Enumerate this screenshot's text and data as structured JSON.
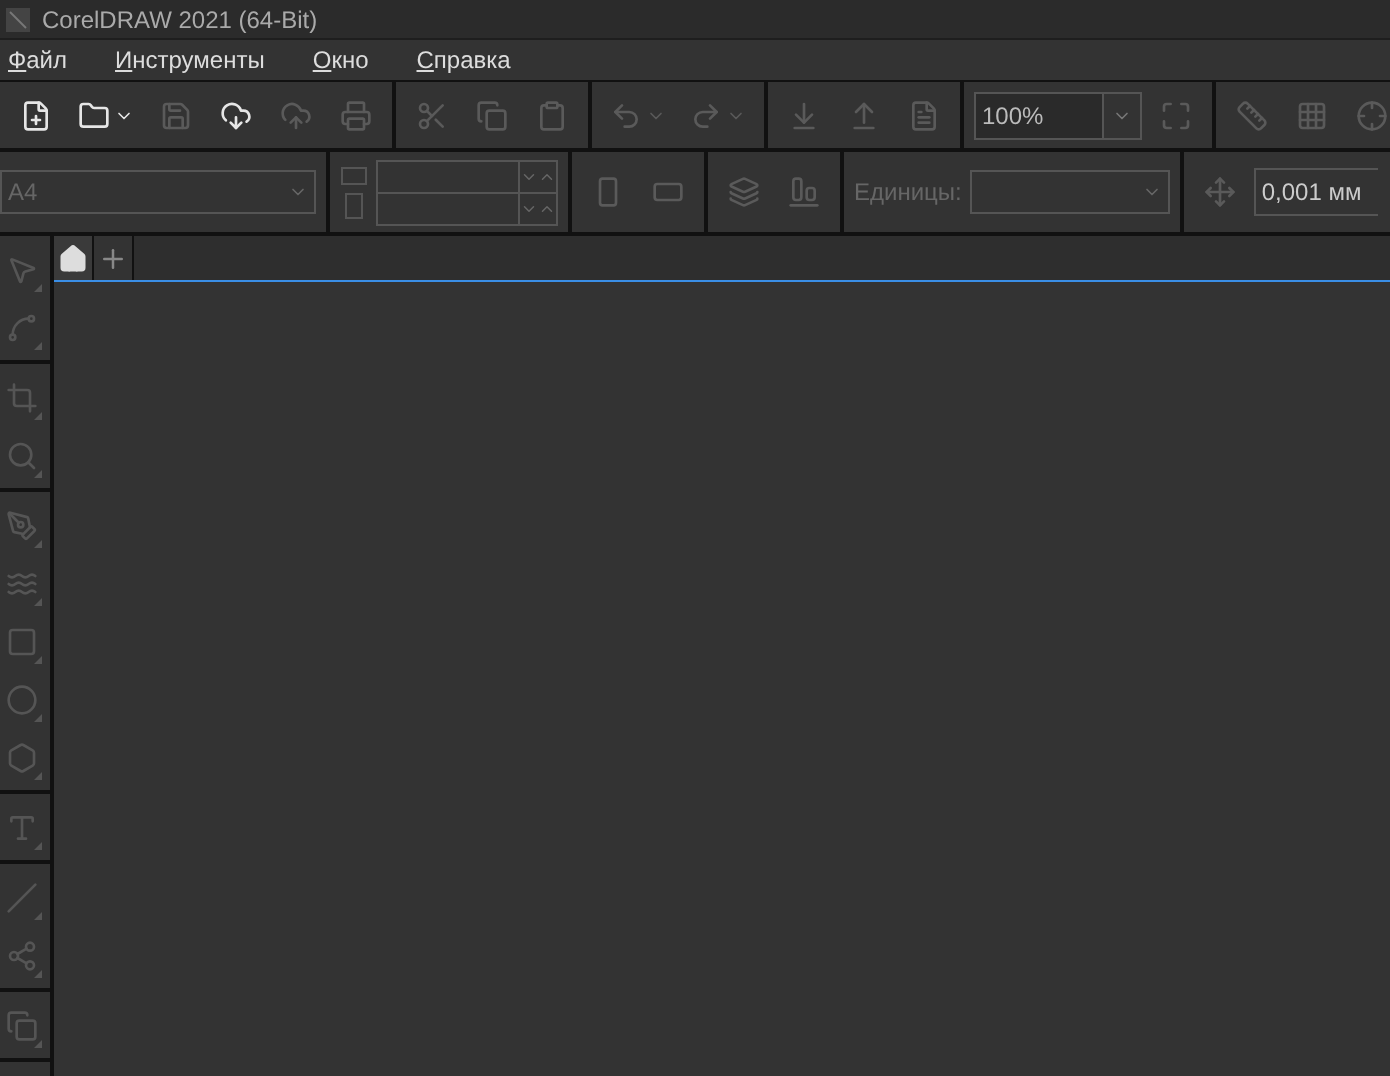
{
  "window": {
    "title": "CorelDRAW 2021 (64-Bit)"
  },
  "menu": [
    "Файл",
    "Инструменты",
    "Окно",
    "Справка"
  ],
  "toolbar": {
    "groups": [
      [
        {
          "disabled": false,
          "menu": false
        },
        {
          "disabled": false,
          "menu": true
        },
        {
          "disabled": true,
          "menu": false
        },
        {
          "disabled": false,
          "menu": false
        },
        {
          "disabled": true,
          "menu": false
        },
        {
          "disabled": true,
          "menu": false
        }
      ],
      [
        {
          "disabled": true,
          "menu": false
        },
        {
          "disabled": true,
          "menu": false
        },
        {
          "disabled": true,
          "menu": false
        }
      ],
      [
        {
          "disabled": true,
          "menu": true
        },
        {
          "disabled": true,
          "menu": true
        }
      ],
      [
        {
          "disabled": true,
          "menu": false
        },
        {
          "disabled": true,
          "menu": false
        },
        {
          "disabled": true,
          "menu": false
        }
      ]
    ],
    "zoom": "100%",
    "view_groups": [
      [
        {
          "disabled": true,
          "menu": false
        }
      ],
      [
        {
          "disabled": true,
          "menu": false
        },
        {
          "disabled": true,
          "menu": false
        },
        {
          "disabled": true,
          "menu": false
        }
      ]
    ]
  },
  "property_bar": {
    "page_size": "A4",
    "units_label": "Единицы:",
    "nudge": "0,001 мм"
  },
  "tabs": [
    {
      "kind": "home",
      "selected": true
    },
    {
      "kind": "add",
      "selected": false
    }
  ],
  "toolbox": [
    [
      {
        "flyout": true
      },
      {
        "flyout": true
      }
    ],
    [
      {
        "flyout": true
      },
      {
        "flyout": true
      }
    ],
    [
      {
        "flyout": true
      },
      {
        "flyout": true
      },
      {
        "flyout": true
      },
      {
        "flyout": true
      },
      {
        "flyout": true
      }
    ],
    [
      {
        "flyout": true
      }
    ],
    [
      {
        "flyout": true
      },
      {
        "flyout": true
      }
    ],
    [
      {
        "flyout": true
      }
    ]
  ]
}
